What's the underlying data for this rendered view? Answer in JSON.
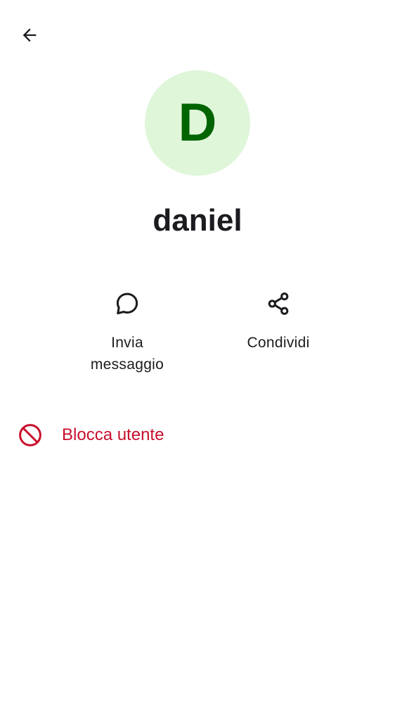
{
  "header": {
    "back_icon": "arrow-back-icon"
  },
  "profile": {
    "avatar_initial": "D",
    "avatar_bg_color": "#dff6d9",
    "avatar_text_color": "#006400",
    "name": "daniel"
  },
  "actions": [
    {
      "label": "Invia messaggio",
      "icon": "chat-bubble-icon"
    },
    {
      "label": "Condividi",
      "icon": "share-icon"
    }
  ],
  "block": {
    "label": "Blocca utente",
    "icon": "block-icon",
    "color": "#c8102e"
  }
}
